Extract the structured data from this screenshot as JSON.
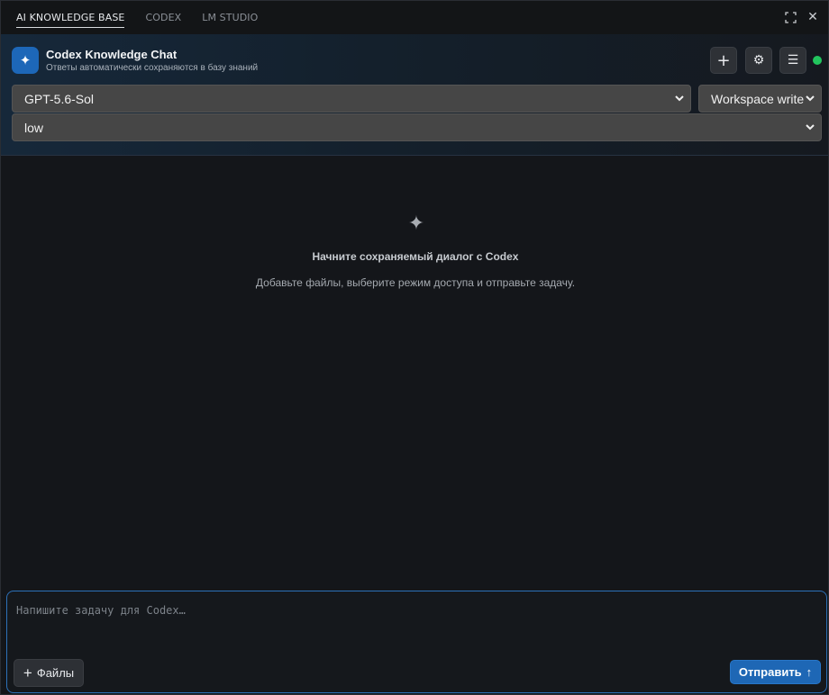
{
  "tabs": [
    {
      "label": "AI KNOWLEDGE BASE",
      "active": true
    },
    {
      "label": "CODEX",
      "active": false
    },
    {
      "label": "LM STUDIO",
      "active": false
    }
  ],
  "window_controls": {
    "expand_icon": "expand-icon",
    "close_icon": "close-icon",
    "close_glyph": "✕"
  },
  "header": {
    "icon_glyph": "✦",
    "title": "Codex Knowledge Chat",
    "subtitle": "Ответы автоматически сохраняются в базу знаний",
    "new_glyph": "+",
    "settings_glyph": "⚙",
    "menu_glyph": "☰",
    "status_color": "#22c55e"
  },
  "selects": {
    "model": "GPT-5.6-Sol",
    "access": "Workspace write",
    "effort": "low"
  },
  "empty_state": {
    "icon_glyph": "✦",
    "title": "Начните сохраняемый диалог с Codex",
    "subtitle": "Добавьте файлы, выберите режим доступа и отправьте задачу."
  },
  "composer": {
    "placeholder": "Напишите задачу для Codex…",
    "value": "",
    "files_icon": "+",
    "files_label": "Файлы",
    "send_label": "Отправить",
    "send_icon": "↑"
  },
  "colors": {
    "accent": "#1e67b5",
    "background": "#14161a"
  }
}
